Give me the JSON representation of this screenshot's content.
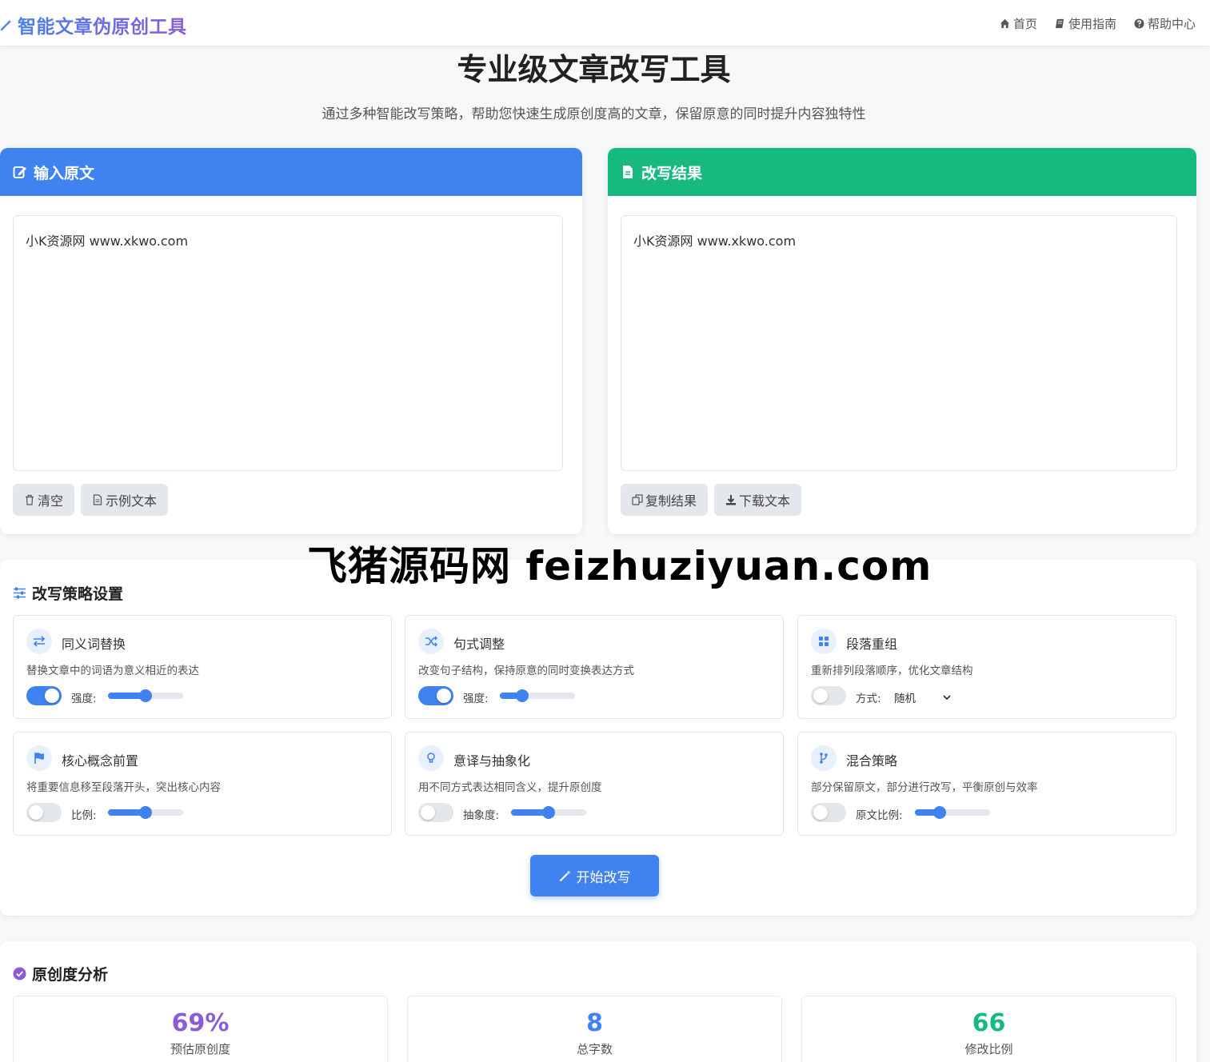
{
  "header": {
    "brand": "智能文章伪原创工具",
    "nav": [
      {
        "label": "首页",
        "icon": "home-icon"
      },
      {
        "label": "使用指南",
        "icon": "book-icon"
      },
      {
        "label": "帮助中心",
        "icon": "question-circle-icon"
      }
    ]
  },
  "hero": {
    "title": "专业级文章改写工具",
    "subtitle": "通过多种智能改写策略，帮助您快速生成原创度高的文章，保留原意的同时提升内容独特性"
  },
  "input_panel": {
    "title": "输入原文",
    "text": "小K资源网 www.xkwo.com",
    "clear_label": "清空",
    "sample_label": "示例文本"
  },
  "output_panel": {
    "title": "改写结果",
    "text": "小K资源网 www.xkwo.com",
    "copy_label": "复制结果",
    "download_label": "下载文本"
  },
  "watermark": "飞猪源码网 feizhuziyuan.com",
  "strategy": {
    "title": "改写策略设置",
    "cards": [
      {
        "title": "同义词替换",
        "desc": "替换文章中的词语为意义相近的表达",
        "enabled": true,
        "control_label": "强度:",
        "value": 0.5
      },
      {
        "title": "句式调整",
        "desc": "改变句子结构，保持原意的同时变换表达方式",
        "enabled": true,
        "control_label": "强度:",
        "value": 0.3
      },
      {
        "title": "段落重组",
        "desc": "重新排列段落顺序，优化文章结构",
        "enabled": false,
        "control_label": "方式:",
        "select_value": "随机"
      },
      {
        "title": "核心概念前置",
        "desc": "将重要信息移至段落开头，突出核心内容",
        "enabled": false,
        "control_label": "比例:",
        "value": 0.5
      },
      {
        "title": "意译与抽象化",
        "desc": "用不同方式表达相同含义，提升原创度",
        "enabled": false,
        "control_label": "抽象度:",
        "value": 0.5
      },
      {
        "title": "混合策略",
        "desc": "部分保留原文，部分进行改写，平衡原创与效率",
        "enabled": false,
        "control_label": "原文比例:",
        "value": 0.33
      }
    ],
    "start_label": "开始改写"
  },
  "analysis": {
    "title": "原创度分析",
    "stats": [
      {
        "value": "69%",
        "label": "预估原创度",
        "color": "#8a5bd6"
      },
      {
        "value": "8",
        "label": "总字数",
        "color": "#3f82f0"
      },
      {
        "value": "66",
        "label": "修改比例",
        "color": "#16ba7e"
      }
    ]
  }
}
